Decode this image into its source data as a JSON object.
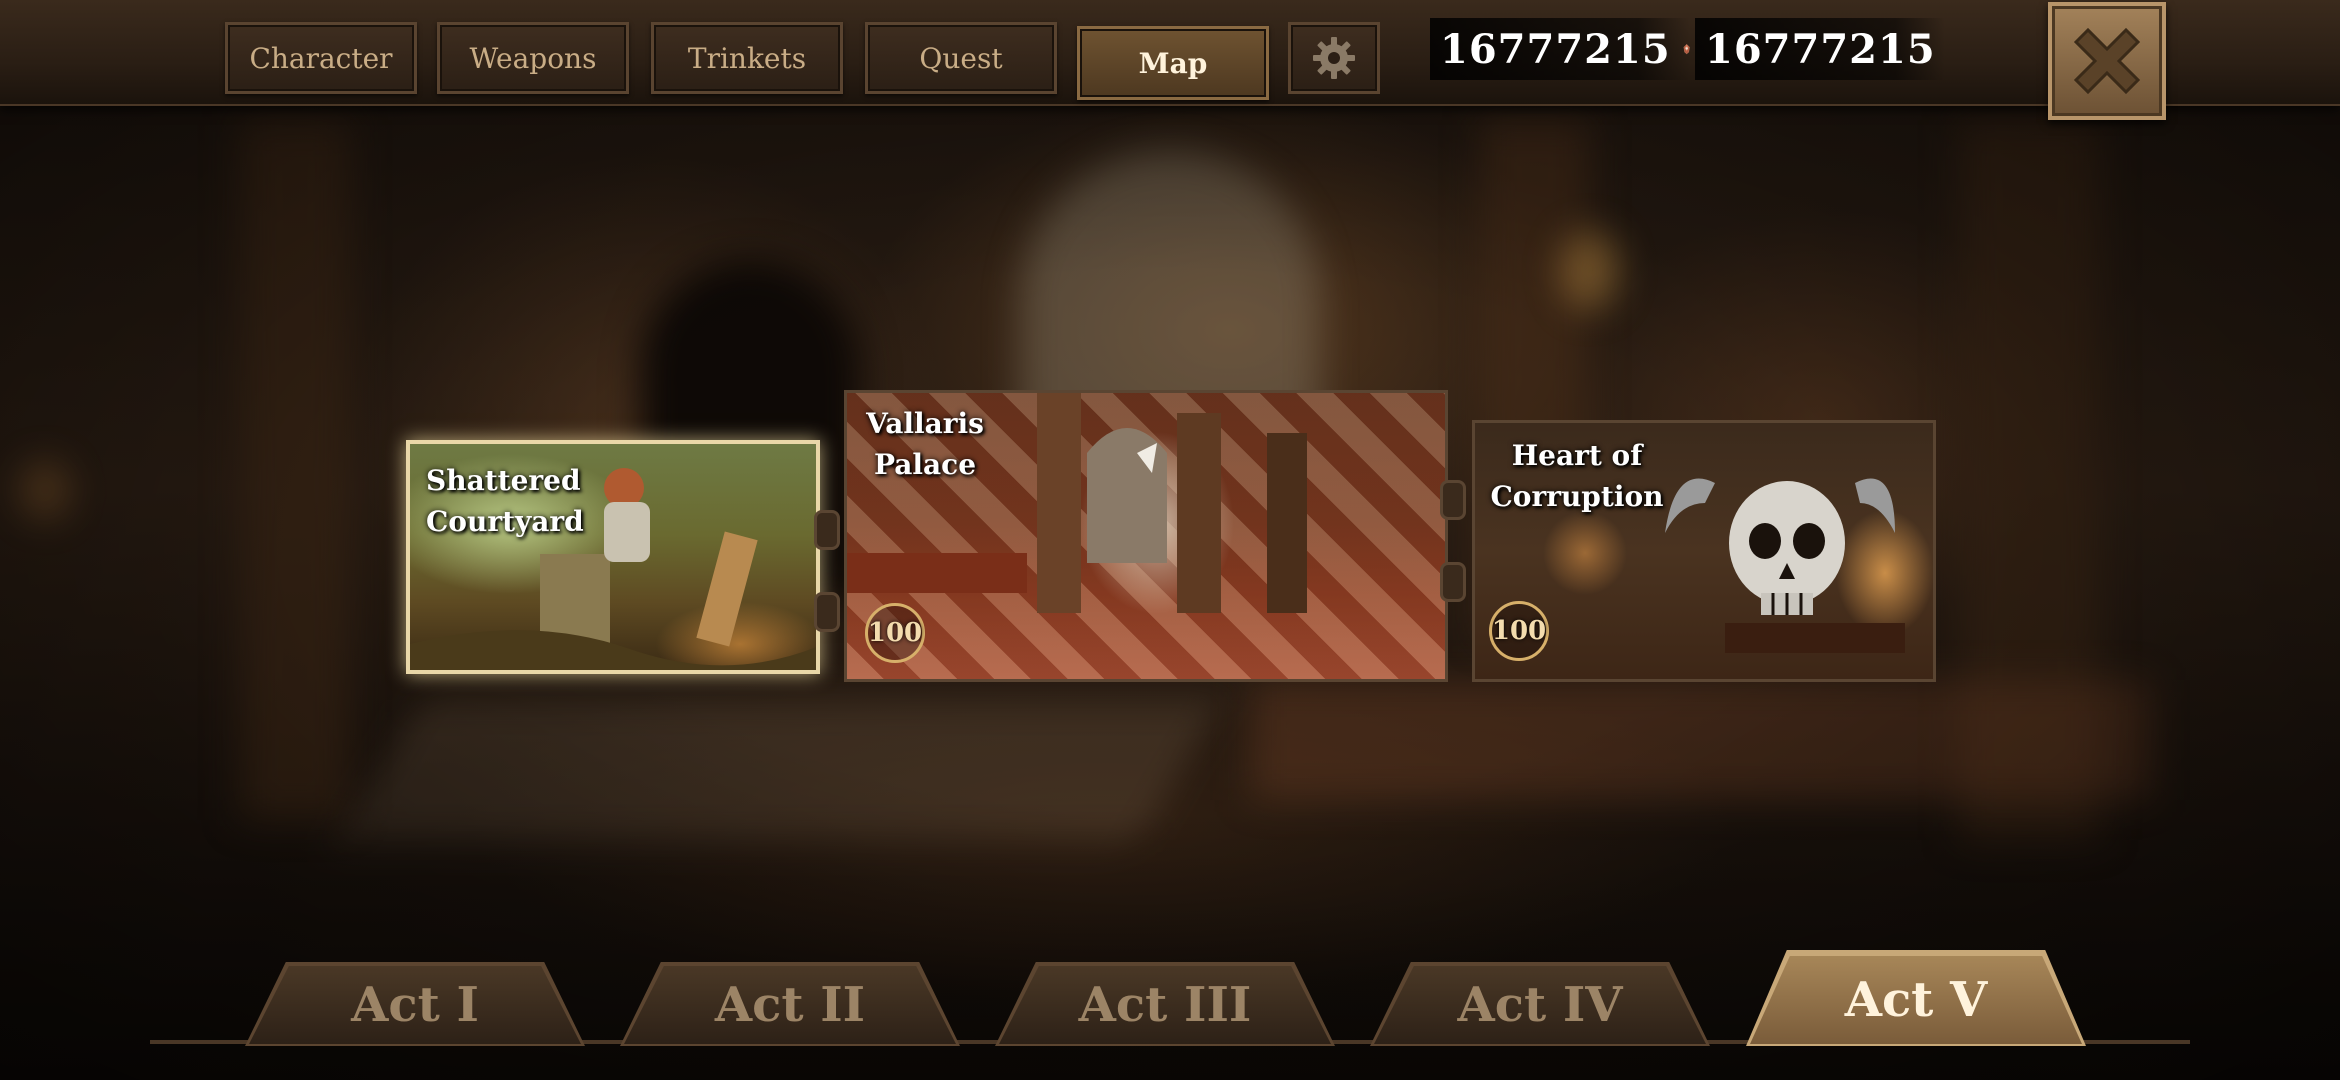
{
  "tabs": [
    {
      "label": "Character",
      "active": false
    },
    {
      "label": "Weapons",
      "active": false
    },
    {
      "label": "Trinkets",
      "active": false
    },
    {
      "label": "Quest",
      "active": false
    },
    {
      "label": "Map",
      "active": true
    }
  ],
  "settings_icon": "gear-icon",
  "currencies": [
    {
      "amount": "16777215",
      "icon": "red-gem-icon",
      "color": "#c0664a"
    },
    {
      "amount": "16777215",
      "icon": "blue-crystal-icon",
      "color": "#4a7ab0"
    }
  ],
  "close_icon": "close-icon",
  "maps": [
    {
      "title_line1": "Shattered",
      "title_line2": "Courtyard",
      "selected": true
    },
    {
      "title_line1": "Vallaris",
      "title_line2": "Palace",
      "level": "100"
    },
    {
      "title_line1": "Heart of",
      "title_line2": "Corruption",
      "level": "100"
    }
  ],
  "acts": [
    {
      "label": "Act I",
      "active": false
    },
    {
      "label": "Act II",
      "active": false
    },
    {
      "label": "Act III",
      "active": false
    },
    {
      "label": "Act IV",
      "active": false
    },
    {
      "label": "Act V",
      "active": true
    }
  ]
}
